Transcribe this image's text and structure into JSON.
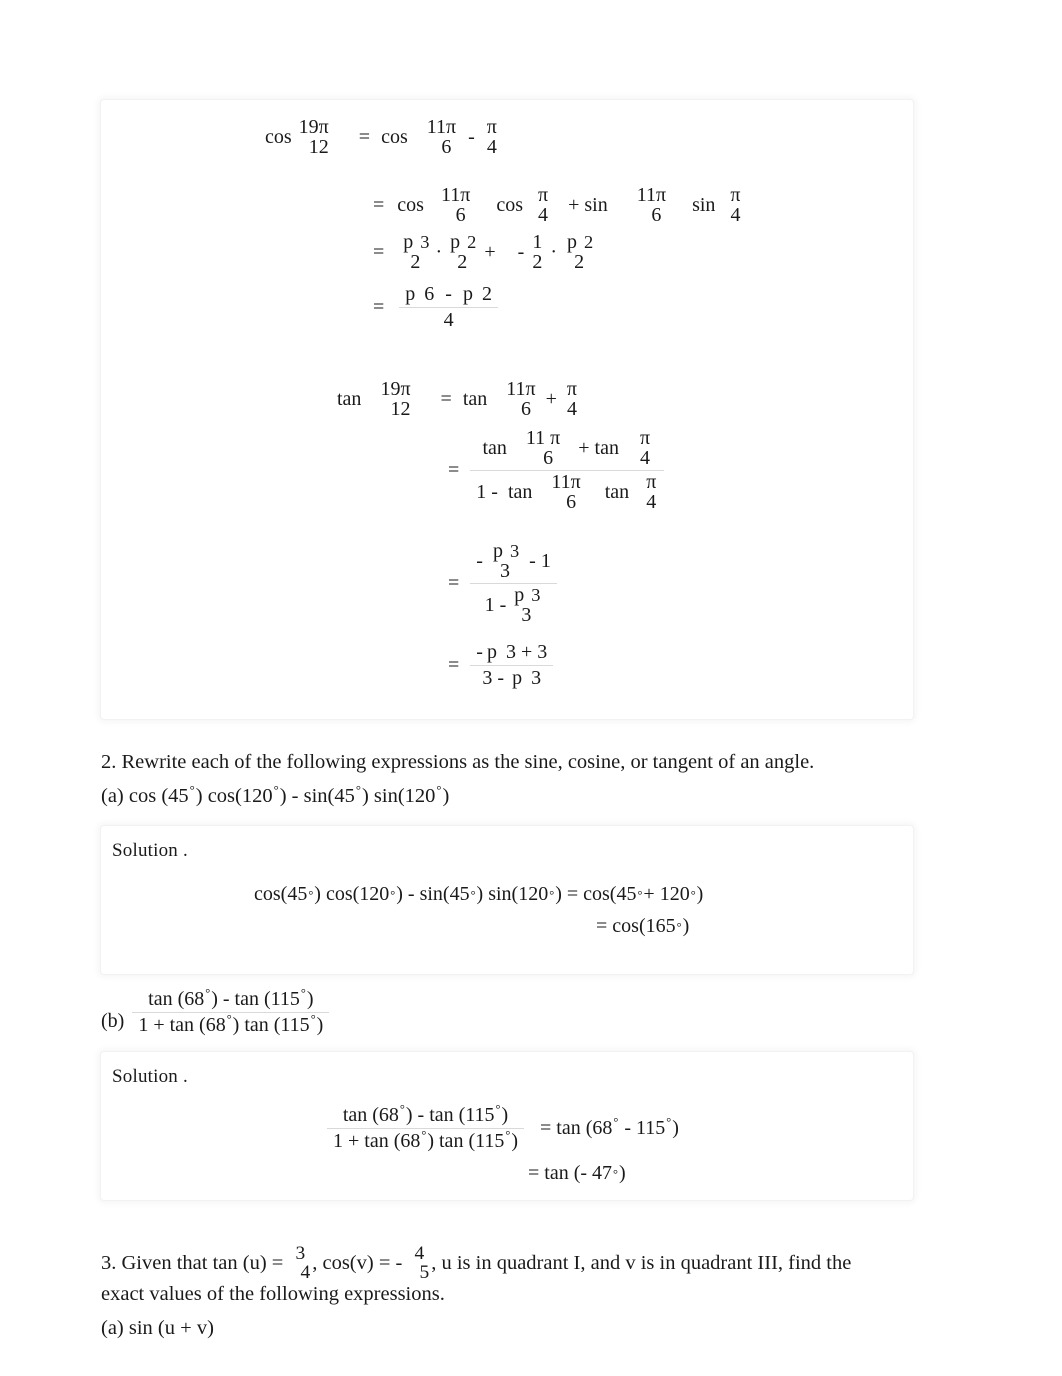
{
  "page": {
    "background": "#ffffff",
    "text_color": "#1a1a1a"
  },
  "panel1": {
    "name": "worked-solution-panel-top",
    "cos_block": {
      "line1": {
        "fn": "cos",
        "arg_num": "19π",
        "arg_den": "12",
        "eq": "=",
        "rhs_fn": "cos",
        "rhs_num": "11π",
        "rhs_den": "6",
        "rhs_op": "-",
        "rhs2_num": "π",
        "rhs2_den": "4"
      },
      "line2": {
        "eq": "=",
        "fn1": "cos",
        "a_num": "11π",
        "a_den": "6",
        "fn2": "cos",
        "b_num": "π",
        "b_den": "4",
        "op": "+ sin",
        "c_num": "11π",
        "c_den": "6",
        "fn3": "sin",
        "d_num": "π",
        "d_den": "4"
      },
      "line3": {
        "eq": "=",
        "t1_rad": "p",
        "t1_num": "3",
        "t1_den": "2",
        "dot1": "·",
        "t2_rad": "p",
        "t2_num": "2",
        "t2_den": "2",
        "plus": "+",
        "minus": "-",
        "t3_num": "1",
        "t3_den": "2",
        "dot2": "·",
        "t4_rad": "p",
        "t4_num": "2",
        "t4_den": "2"
      },
      "line4": {
        "eq": "=",
        "rad1": "p",
        "n1": "6",
        "minus": "-",
        "rad2": "p",
        "n2": "2",
        "den": "4"
      }
    },
    "tan_block": {
      "line1": {
        "fn": "tan",
        "arg_num": "19π",
        "arg_den": "12",
        "eq": "=",
        "rhs_fn": "tan",
        "rhs_num": "11π",
        "rhs_den": "6",
        "rhs_op": "+",
        "rhs2_num": "π",
        "rhs2_den": "4"
      },
      "line2": {
        "eq": "=",
        "num_fn1": "tan",
        "num_a_num": "11 π",
        "num_a_den": "6",
        "num_op": "+ tan",
        "num_b_num": "π",
        "num_b_den": "4",
        "den_one": "1 -",
        "den_fn1": "tan",
        "den_a_num": "11π",
        "den_a_den": "6",
        "den_fn2": "tan",
        "den_b_num": "π",
        "den_b_den": "4"
      },
      "line3": {
        "eq": "=",
        "num_minus": "-",
        "num_rad": "p",
        "num_top": "3",
        "num_bot": "3",
        "num_tail": "- 1",
        "den_one": "1 -",
        "den_rad": "p",
        "den_top": "3",
        "den_bot": "3"
      },
      "line4": {
        "eq": "=",
        "num_minus": "-",
        "num_rad": "p",
        "num_top": "3 + 3",
        "den_three": "3 -",
        "den_rad": "p",
        "den_top": "3"
      }
    }
  },
  "question2": {
    "prompt": "2.  Rewrite each of the following expressions as the sine, cosine, or tangent of an angle.",
    "part_a": {
      "label": "(a)",
      "expr": "cos (45°) cos(120°) -  sin(45°) sin(120°)",
      "pieces": {
        "p1": "(a) cos (45",
        "d1": "°",
        "p2": ") cos(120",
        "d2": "°",
        "p3": ") -  sin(45",
        "d3": "°",
        "p4": ") sin(120",
        "d4": "°",
        "p5": ")"
      }
    },
    "part_b": {
      "label": "(b)",
      "num_p1": "tan (68",
      "num_d1": "°",
      "num_p2": ") -  tan (115",
      "num_d2": "°",
      "num_p3": ")",
      "den_p1": "1 + tan (68",
      "den_d1": "°",
      "den_p2": ") tan (115",
      "den_d2": "°",
      "den_p3": ")"
    }
  },
  "solution_a": {
    "label": "Solution .",
    "line1": {
      "p1": "cos(45",
      "d1": "°",
      "p2": ") cos(120",
      "d2": "°",
      "p3": ") -  sin(45",
      "d3": "°",
      "p4": ") sin(120",
      "d4": "°",
      "p5": ") =  cos(45",
      "d5": "°",
      "p6": " + 120",
      "d6": "°",
      "p7": ")"
    },
    "line2": {
      "p1": "=  cos(165",
      "d1": "°",
      "p2": ")"
    }
  },
  "solution_b": {
    "label": "Solution .",
    "frac": {
      "num_p1": "tan (68",
      "num_d1": "°",
      "num_p2": ") -  tan (115",
      "num_d2": "°",
      "num_p3": ")",
      "den_p1": "1 + tan (68",
      "den_d1": "°",
      "den_p2": ") tan (115",
      "den_d2": "°",
      "den_p3": ")"
    },
    "line1": {
      "p1": "=  tan (68",
      "d1": "°",
      "p2": " -  115",
      "d2": "°",
      "p3": ")"
    },
    "line2": {
      "p1": "=  tan (-  47",
      "d1": "°",
      "p2": ")"
    }
  },
  "question3": {
    "p1": "3.  Given that tan  (u) = ",
    "tanu_num": "3",
    "tanu_den": "4",
    "p2": ", cos(v) =  - ",
    "cosv_num": "4",
    "cosv_den": "5",
    "p3": ", u is in quadrant I, and    v is in quadrant III, find the",
    "line2": "exact values of the following expressions.",
    "part_a": "(a) sin (u + v)"
  }
}
